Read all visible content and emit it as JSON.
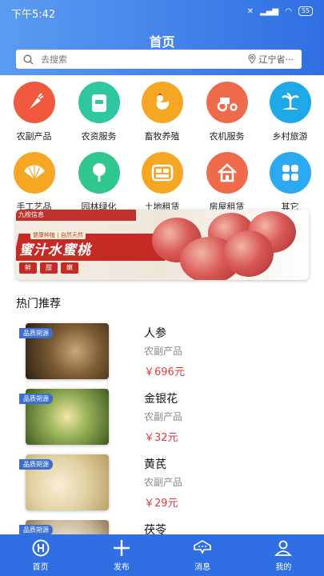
{
  "status": {
    "time": "下午5:42",
    "battery": "55"
  },
  "header": {
    "title": "首页"
  },
  "search": {
    "placeholder": "去搜索",
    "location": "辽宁省···"
  },
  "categories": [
    {
      "label": "农副产品",
      "color": "#f0593e",
      "icon": "carrot-icon"
    },
    {
      "label": "农资服务",
      "color": "#2fc7a0",
      "icon": "fertilizer-bag-icon"
    },
    {
      "label": "畜牧养殖",
      "color": "#f5a623",
      "icon": "rooster-icon"
    },
    {
      "label": "农机服务",
      "color": "#f06a4c",
      "icon": "tractor-icon"
    },
    {
      "label": "乡村旅游",
      "color": "#1fa8e8",
      "icon": "palm-island-icon"
    },
    {
      "label": "手工艺品",
      "color": "#f5a623",
      "icon": "fan-icon"
    },
    {
      "label": "园林绿化",
      "color": "#2fc78e",
      "icon": "tree-icon"
    },
    {
      "label": "土地租赁",
      "color": "#f5a623",
      "icon": "land-plots-icon"
    },
    {
      "label": "房屋租赁",
      "color": "#f06a4c",
      "icon": "house-icon"
    },
    {
      "label": "其它",
      "color": "#2aa9f0",
      "icon": "more-grid-icon"
    }
  ],
  "banner": {
    "tag": "九桉信息",
    "small": "健康种植 | 自然天然",
    "main": "蜜汁水蜜桃",
    "chips": [
      "鲜",
      "甜",
      "嫩"
    ]
  },
  "section": {
    "title": "热门推荐"
  },
  "products": [
    {
      "badge": "品质朔源",
      "name": "人参",
      "category": "农副产品",
      "price": "￥696元"
    },
    {
      "badge": "品质朔源",
      "name": "金银花",
      "category": "农副产品",
      "price": "￥32元"
    },
    {
      "badge": "品质朔源",
      "name": "黄芪",
      "category": "农副产品",
      "price": "￥29元"
    },
    {
      "badge": "品质朔源",
      "name": "茯苓",
      "category": "",
      "price": ""
    }
  ],
  "tabbar": [
    {
      "label": "首页",
      "icon": "home-logo-icon"
    },
    {
      "label": "发布",
      "icon": "plus-icon"
    },
    {
      "label": "消息",
      "icon": "message-bubble-icon"
    },
    {
      "label": "我的",
      "icon": "user-icon"
    }
  ]
}
